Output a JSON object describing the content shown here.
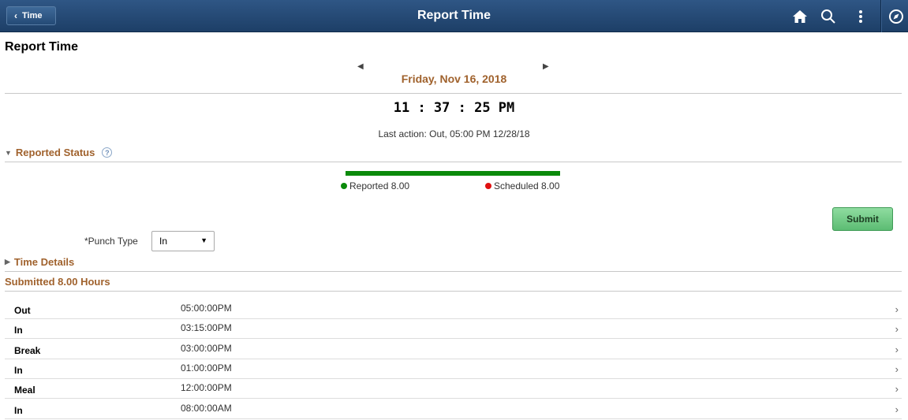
{
  "header": {
    "back_label": "Time",
    "title": "Report Time"
  },
  "page": {
    "title": "Report Time",
    "date": "Friday, Nov 16, 2018",
    "clock": "11 : 37 : 25 PM",
    "last_action": "Last action: Out, 05:00 PM 12/28/18"
  },
  "reported_status": {
    "heading": "Reported Status",
    "reported_fraction": 1.0,
    "reported_label": "Reported 8.00",
    "scheduled_label": "Scheduled 8.00",
    "colors": {
      "bar": "#0b8a0b",
      "reported": "#0b8a0b",
      "scheduled": "#e01010"
    }
  },
  "form": {
    "submit_label": "Submit",
    "punch_type_label": "*Punch Type",
    "punch_type_value": "In"
  },
  "time_details": {
    "heading": "Time Details"
  },
  "submitted": {
    "heading": "Submitted 8.00 Hours",
    "rows": [
      {
        "type": "Out",
        "time": "05:00:00PM"
      },
      {
        "type": "In",
        "time": "03:15:00PM"
      },
      {
        "type": "Break",
        "time": "03:00:00PM"
      },
      {
        "type": "In",
        "time": "01:00:00PM"
      },
      {
        "type": "Meal",
        "time": "12:00:00PM"
      },
      {
        "type": "In",
        "time": "08:00:00AM"
      }
    ]
  },
  "icons": {
    "back": "chevron-left-icon",
    "home": "home-icon",
    "search": "search-icon",
    "actions": "more-vertical-icon",
    "navbar": "compass-icon",
    "help": "help-icon",
    "row_nav": "chevron-right-icon"
  }
}
